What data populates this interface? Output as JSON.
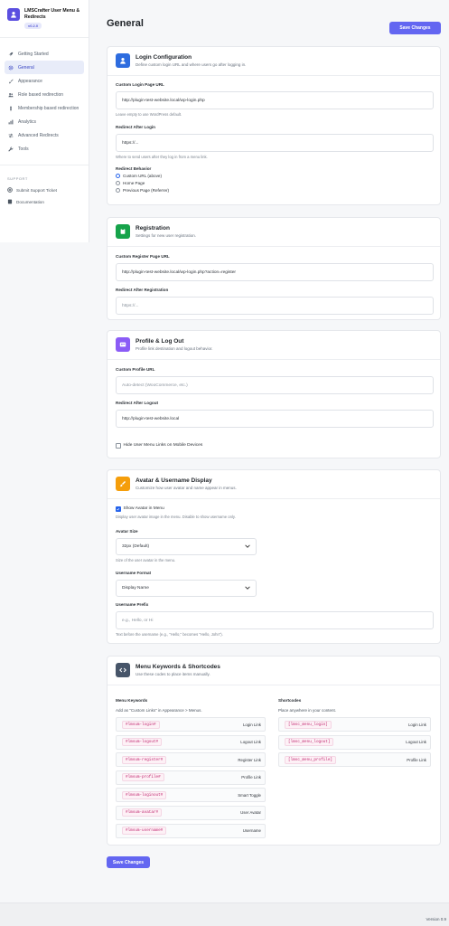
{
  "brand": {
    "title": "LMSCrafter User Menu & Redirects",
    "version": "v0.2.0"
  },
  "nav": [
    {
      "label": "Getting Started",
      "icon": "rocket-icon",
      "active": false
    },
    {
      "label": "General",
      "icon": "gear-icon",
      "active": true
    },
    {
      "label": "Appearance",
      "icon": "brush-icon",
      "active": false
    },
    {
      "label": "Role based redirection",
      "icon": "users-icon",
      "active": false
    },
    {
      "label": "Membership based redirection",
      "icon": "person-icon",
      "active": false
    },
    {
      "label": "Analytics",
      "icon": "chart-icon",
      "active": false
    },
    {
      "label": "Advanced Redirects",
      "icon": "arrows-icon",
      "active": false
    },
    {
      "label": "Tools",
      "icon": "wrench-icon",
      "active": false
    }
  ],
  "support": {
    "heading": "SUPPORT",
    "items": [
      {
        "label": "Submit Support Ticket",
        "icon": "lifebuoy-icon"
      },
      {
        "label": "Documentation",
        "icon": "book-icon"
      }
    ]
  },
  "page": {
    "title": "General",
    "save_label": "Save Changes"
  },
  "login": {
    "title": "Login Configuration",
    "subtitle": "Define custom login URL and where users go after logging in.",
    "custom_url_label": "Custom Login Page URL",
    "custom_url_value": "http://plugin-test-website.local/wp-login.php",
    "custom_url_help": "Leave empty to use WordPress default.",
    "redirect_label": "Redirect After Login",
    "redirect_placeholder": "https://...",
    "redirect_help": "Where to send users after they log in from a menu link.",
    "behavior_label": "Redirect Behavior",
    "behavior_options": [
      "Custom URL (above)",
      "Home Page",
      "Previous Page (Referrer)"
    ],
    "behavior_selected": 0
  },
  "registration": {
    "title": "Registration",
    "subtitle": "Settings for new user registration.",
    "url_label": "Custom Register Page URL",
    "url_value": "http://plugin-test-website.local/wp-login.php?action=register",
    "redirect_label": "Redirect After Registration",
    "redirect_placeholder": "https://..."
  },
  "profile": {
    "title": "Profile & Log Out",
    "subtitle": "Profile link destination and logout behavior.",
    "url_label": "Custom Profile URL",
    "url_placeholder": "Auto-detect (WooCommerce, etc.)",
    "logout_label": "Redirect After Logout",
    "logout_value": "http://plugin-test-website.local",
    "hide_mobile_label": "Hide User Menu Links on Mobile Devices",
    "hide_mobile_checked": false
  },
  "avatar": {
    "title": "Avatar & Username Display",
    "subtitle": "Customize how user avatar and name appear in menus.",
    "show_label": "Show Avatar in Menu",
    "show_checked": true,
    "show_help": "Display user avatar image in the menu. Disable to show username only.",
    "size_label": "Avatar Size",
    "size_value": "32px (Default)",
    "size_help": "Size of the user avatar in the menu.",
    "format_label": "Username Format",
    "format_value": "Display Name",
    "prefix_label": "Username Prefix",
    "prefix_placeholder": "e.g., Hello, or Hi",
    "prefix_help": "Text before the username (e.g., \"Hello,\" becomes \"Hello, John\")."
  },
  "shortcodes": {
    "title": "Menu Keywords & Shortcodes",
    "subtitle": "Use these codes to place items manually.",
    "keywords_heading": "Menu Keywords",
    "keywords_help": "Add as \"Custom Links\" in Appearance > Menus.",
    "keywords": [
      {
        "code": "#lmsum-login#",
        "desc": "Login Link"
      },
      {
        "code": "#lmsum-logout#",
        "desc": "Logout Link"
      },
      {
        "code": "#lmsum-register#",
        "desc": "Register Link"
      },
      {
        "code": "#lmsum-profile#",
        "desc": "Profile Link"
      },
      {
        "code": "#lmsum-loginout#",
        "desc": "Smart Toggle"
      },
      {
        "code": "#lmsum-avatar#",
        "desc": "User Avatar"
      },
      {
        "code": "#lmsum-username#",
        "desc": "Username"
      }
    ],
    "short_heading": "Shortcodes",
    "short_help": "Place anywhere in your content.",
    "shortcodes": [
      {
        "code": "[lmsc_menu_login]",
        "desc": "Login Link"
      },
      {
        "code": "[lmsc_menu_logout]",
        "desc": "Logout Link"
      },
      {
        "code": "[lmsc_menu_profile]",
        "desc": "Profile Link"
      }
    ]
  },
  "footer": {
    "version": "Version 0.9"
  },
  "colors": {
    "accent": "#6366f1",
    "active_nav": "#e8ecf9",
    "code_text": "#c0266f"
  }
}
